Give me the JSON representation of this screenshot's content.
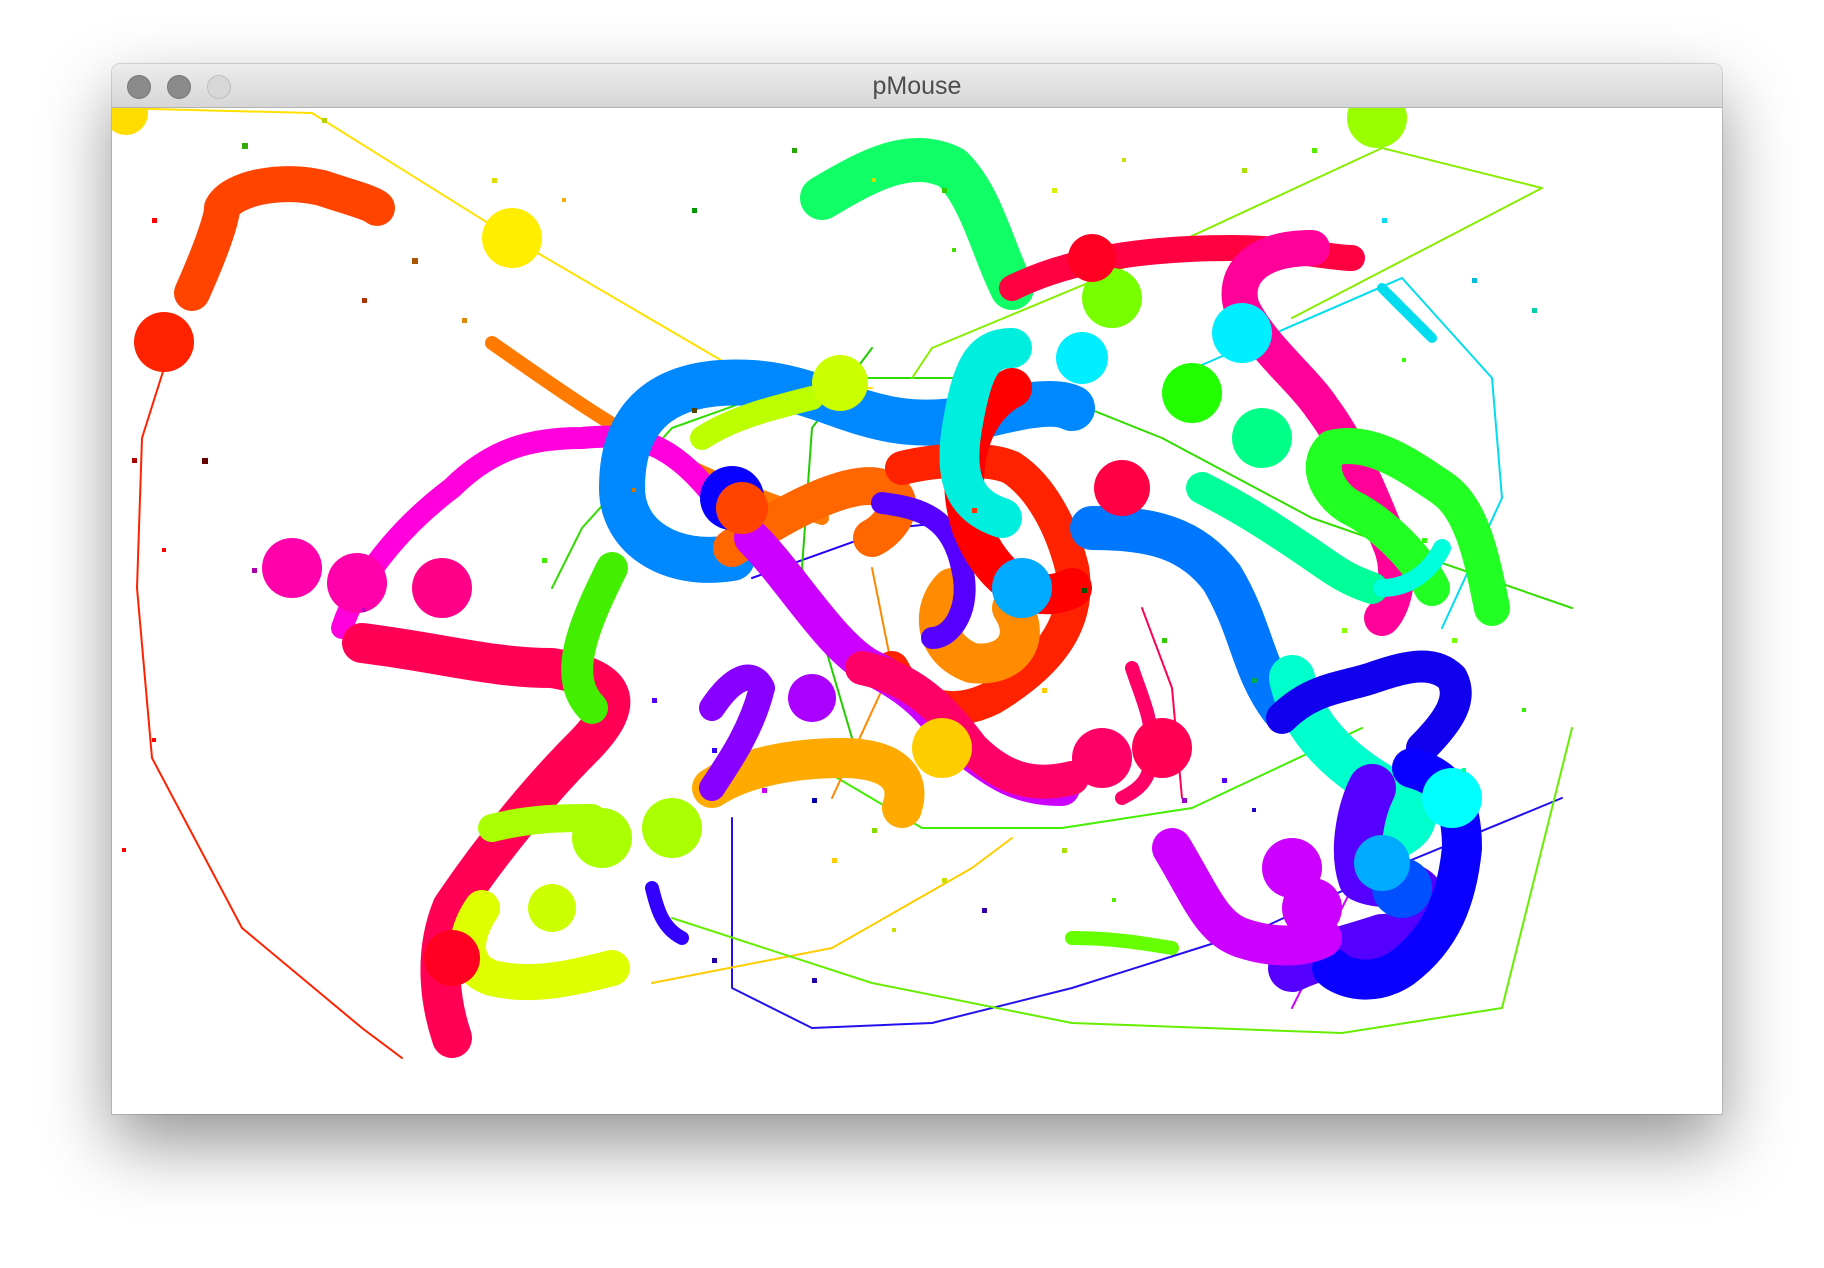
{
  "window": {
    "title": "pMouse"
  },
  "traffic_lights": {
    "close": "close-button",
    "minimize": "minimize-button",
    "zoom": "zoom-button"
  },
  "colors": {
    "titlebar": "#dcdcdc",
    "title_text": "#4d4d4d",
    "canvas_bg": "#ffffff",
    "stroke_red": "#ff1a0a",
    "stroke_magenta": "#ff00cc",
    "stroke_blue": "#0066ff",
    "stroke_green": "#33ff00",
    "stroke_yellow": "#ffe600",
    "stroke_orange": "#ff8c00",
    "stroke_cyan": "#00ffe0",
    "stroke_purple": "#8800ff",
    "stroke_pink": "#ff0066"
  }
}
